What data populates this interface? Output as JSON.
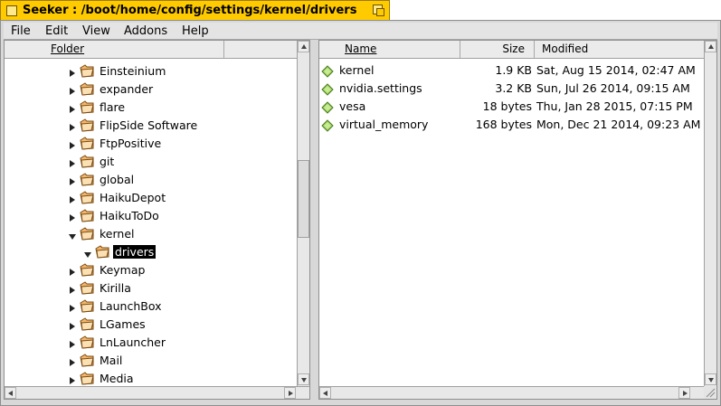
{
  "window": {
    "title": "Seeker : /boot/home/config/settings/kernel/drivers"
  },
  "menu": [
    "File",
    "Edit",
    "View",
    "Addons",
    "Help"
  ],
  "tree": {
    "header": "Folder",
    "items": [
      {
        "label": "Einsteinium",
        "expanded": false
      },
      {
        "label": "expander",
        "expanded": false
      },
      {
        "label": "flare",
        "expanded": false
      },
      {
        "label": "FlipSide Software",
        "expanded": false
      },
      {
        "label": "FtpPositive",
        "expanded": false
      },
      {
        "label": "git",
        "expanded": false
      },
      {
        "label": "global",
        "expanded": false
      },
      {
        "label": "HaikuDepot",
        "expanded": false
      },
      {
        "label": "HaikuToDo",
        "expanded": false
      },
      {
        "label": "kernel",
        "expanded": true
      },
      {
        "label": "drivers",
        "expanded": true,
        "selected": true,
        "child": true
      },
      {
        "label": "Keymap",
        "expanded": false
      },
      {
        "label": "Kirilla",
        "expanded": false
      },
      {
        "label": "LaunchBox",
        "expanded": false
      },
      {
        "label": "LGames",
        "expanded": false
      },
      {
        "label": "LnLauncher",
        "expanded": false
      },
      {
        "label": "Mail",
        "expanded": false
      },
      {
        "label": "Media",
        "expanded": false
      }
    ]
  },
  "files": {
    "columns": [
      "Name",
      "Size",
      "Modified"
    ],
    "rows": [
      {
        "name": "kernel",
        "size": "1.9 KB",
        "modified": "Sat, Aug 15 2014, 02:47 AM"
      },
      {
        "name": "nvidia.settings",
        "size": "3.2 KB",
        "modified": "Sun, Jul 26 2014, 09:15 AM"
      },
      {
        "name": "vesa",
        "size": "18 bytes",
        "modified": "Thu, Jan 28 2015, 07:15 PM"
      },
      {
        "name": "virtual_memory",
        "size": "168 bytes",
        "modified": "Mon, Dec 21 2014, 09:23 AM"
      }
    ]
  },
  "colors": {
    "title_tab": "#ffcb00",
    "selection": "#000000",
    "folder": "#f3b66b",
    "file_icon": "#9ad05a"
  },
  "icons": {
    "folder": "folder-icon",
    "file": "file-icon",
    "collapsed": "triangle-right-icon",
    "expanded": "triangle-down-icon"
  }
}
